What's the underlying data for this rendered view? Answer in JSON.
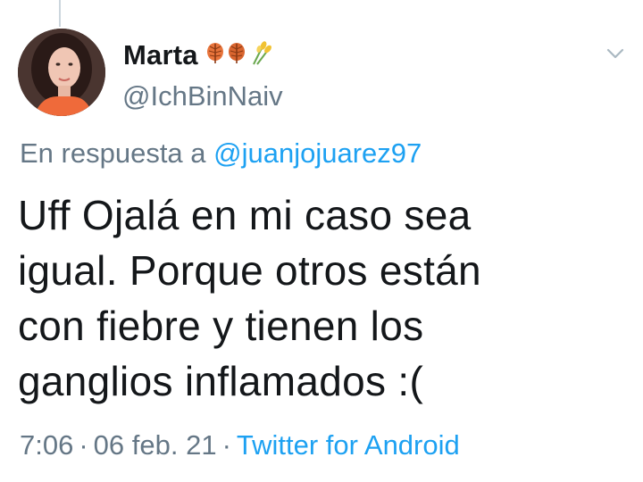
{
  "tweet": {
    "display_name": "Marta",
    "name_emojis": [
      "leaf-emoji",
      "leaf-emoji",
      "sheaf-of-rice-emoji"
    ],
    "handle": "@IchBinNaiv",
    "reply_prefix": "En respuesta a",
    "reply_to": "@juanjojuarez97",
    "text_lines": [
      "Uff Ojalá en mi caso sea",
      "igual. Porque otros están",
      "con fiebre y tienen los",
      "ganglios inflamados :("
    ],
    "time": "7:06",
    "separator": "·",
    "date": "06 feb. 21",
    "source": "Twitter for Android"
  },
  "colors": {
    "text": "#14171a",
    "secondary": "#657786",
    "link": "#1da1f2",
    "divider": "#ccd6dd"
  }
}
